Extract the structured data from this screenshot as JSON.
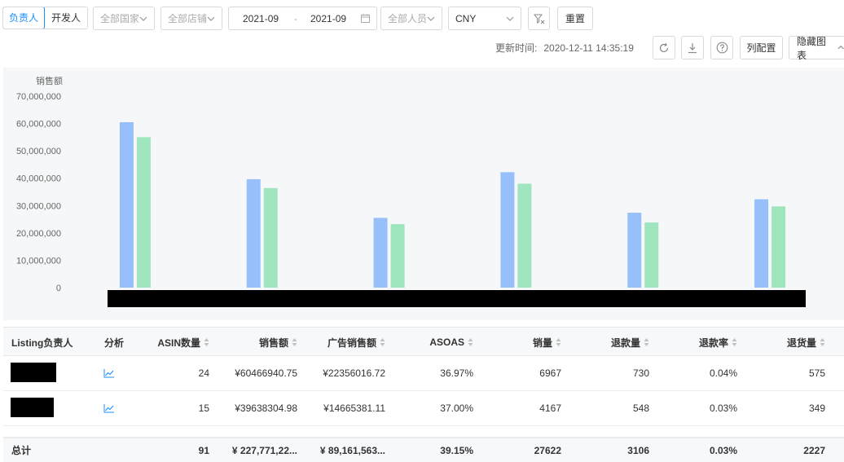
{
  "filters": {
    "owner_tab": "负责人",
    "developer_tab": "开发人",
    "country_select": "全部国家",
    "store_select": "全部店铺",
    "date_start": "2021-09",
    "date_sep": "-",
    "date_end": "2021-09",
    "person_select": "全部人员",
    "currency_select": "CNY",
    "reset_button": "重置"
  },
  "toolbar": {
    "update_label": "更新时间:",
    "update_time": "2020-12-11 14:35:19",
    "columns_button": "列配置",
    "hide_chart_button": "隐藏图表"
  },
  "chart_data": {
    "type": "bar",
    "ylabel": "销售额",
    "ylim": [
      0,
      70000000
    ],
    "yticks": [
      "70,000,000",
      "60,000,000",
      "50,000,000",
      "40,000,000",
      "30,000,000",
      "20,000,000",
      "10,000,000",
      "0"
    ],
    "categories": [
      "",
      "",
      "",
      "",
      "",
      ""
    ],
    "series": [
      {
        "values": [
          60466940.75,
          39638304.98,
          25500000,
          42200000,
          27400000,
          32300000
        ],
        "color": "#97bff9"
      },
      {
        "values": [
          55000000,
          36400000,
          23200000,
          38000000,
          23800000,
          29700000
        ],
        "color": "#9fe5bd"
      }
    ]
  },
  "table": {
    "columns": [
      "Listing负责人",
      "分析",
      "ASIN数量",
      "销售额",
      "广告销售额",
      "ASOAS",
      "销量",
      "退款量",
      "退款率",
      "退货量"
    ],
    "rows": [
      {
        "asin": "24",
        "sales": "¥60466940.75",
        "ad_sales": "¥22356016.72",
        "asoas": "36.97%",
        "qty": "6967",
        "refund": "730",
        "refund_rate": "0.04%",
        "returns": "575"
      },
      {
        "asin": "15",
        "sales": "¥39638304.98",
        "ad_sales": "¥14665381.11",
        "asoas": "37.00%",
        "qty": "4167",
        "refund": "548",
        "refund_rate": "0.03%",
        "returns": "349"
      }
    ],
    "total": {
      "label": "总计",
      "asin": "91",
      "sales": "¥ 227,771,22...",
      "ad_sales": "¥ 89,161,563...",
      "asoas": "39.15%",
      "qty": "27622",
      "refund": "3106",
      "refund_rate": "0.03%",
      "returns": "2227"
    }
  },
  "colors": {
    "accent": "#1890ff",
    "bar_blue": "#97bff9",
    "bar_green": "#9fe5bd"
  }
}
